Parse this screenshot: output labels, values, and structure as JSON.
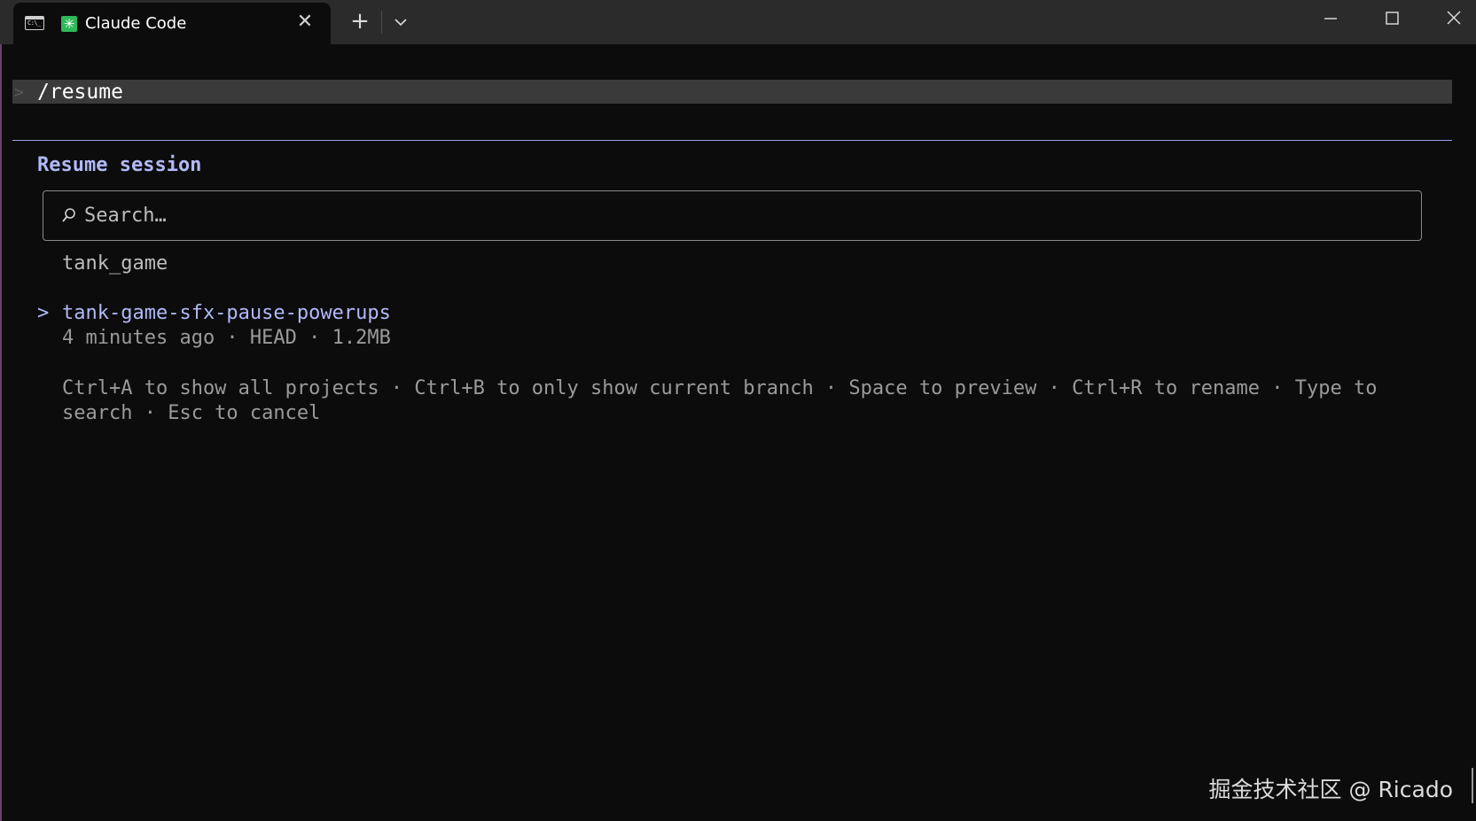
{
  "window": {
    "tab_title": "Claude Code",
    "tab_icon": "terminal-icon",
    "app_icon": "claude-asterisk-icon",
    "app_icon_glyph": "✳",
    "close_glyph": "✕",
    "new_tab_glyph": "+",
    "minimize_glyph": "—",
    "maximize_glyph": "☐",
    "window_close_glyph": "✕",
    "accent_tab_icon": "#2fb85a"
  },
  "prompt": {
    "caret": ">",
    "command": "/resume"
  },
  "panel": {
    "title": "Resume session",
    "search_placeholder": "Search…",
    "project": "tank_game",
    "cursor": ">",
    "sessions": [
      {
        "name": "tank-game-sfx-pause-powerups",
        "meta": "4 minutes ago · HEAD · 1.2MB",
        "selected": true
      }
    ],
    "help_text": "Ctrl+A to show all projects · Ctrl+B to only show current branch · Space to preview · Ctrl+R to rename · Type to search · Esc to cancel"
  },
  "watermark": "掘金技术社区 @ Ricado",
  "colors": {
    "background": "#0c0c0c",
    "titlebar": "#2b2b2b",
    "accent": "#b1b9f9",
    "muted": "#9a9a9a"
  }
}
